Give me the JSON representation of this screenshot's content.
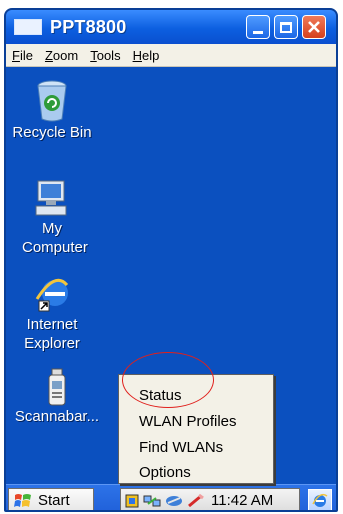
{
  "window": {
    "title": "PPT8800",
    "icon": "app-window-icon"
  },
  "title_buttons": {
    "minimize": "minimize-icon",
    "maximize": "maximize-icon",
    "close": "close-icon"
  },
  "menubar": {
    "items": [
      {
        "label": "File",
        "underline": "F"
      },
      {
        "label": "Zoom",
        "underline": "Z"
      },
      {
        "label": "Tools",
        "underline": "T"
      },
      {
        "label": "Help",
        "underline": "H"
      }
    ]
  },
  "desktop": {
    "icons": [
      {
        "label": "Recycle Bin",
        "icon": "recycle-bin-icon"
      },
      {
        "label": "My Computer",
        "icon": "my-computer-icon"
      },
      {
        "label": "Internet Explorer",
        "icon": "internet-explorer-icon"
      },
      {
        "label": "Scannabar...",
        "icon": "scannabar-icon"
      }
    ]
  },
  "popup_menu": {
    "items": [
      "Status",
      "WLAN Profiles",
      "Find WLANs",
      "Options"
    ]
  },
  "taskbar": {
    "start_label": "Start",
    "clock": "11:42 AM"
  },
  "colors": {
    "desktop": "#0b50bf",
    "titlebar": "#0c5fe0",
    "annotation": "#e0201c"
  }
}
